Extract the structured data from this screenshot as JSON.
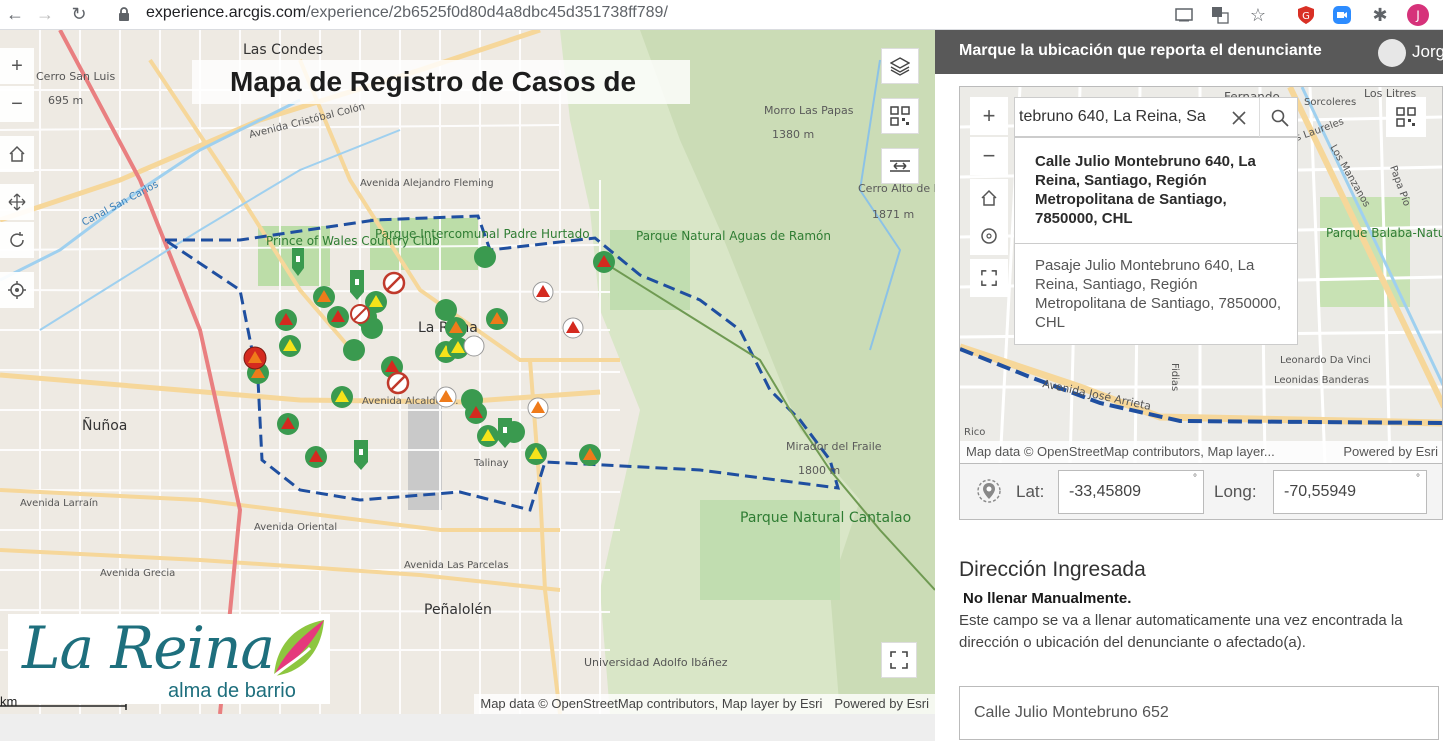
{
  "browser": {
    "url_domain": "experience.arcgis.com",
    "url_path": "/experience/2b6525f0d80d4a8dbc45d351738ff789/"
  },
  "map": {
    "title": "Mapa de Registro de Casos de",
    "labels": {
      "las_condes": "Las Condes",
      "cerro_san_luis": "Cerro San Luis",
      "cerro_san_luis_alt": "695 m",
      "morro_las_papas": "Morro Las Papas",
      "morro_alt": "1380 m",
      "cerro_alto": "Cerro Alto de las Vizcachas",
      "cerro_alto_alt": "1871 m",
      "parque_intercomunal": "Parque Intercomunal Padre Hurtado",
      "prince_of_wales": "Prince of Wales Country Club",
      "parque_aguas": "Parque Natural Aguas de Ramón",
      "la_reina": "La Reina",
      "nunoa": "Ñuñoa",
      "mirador": "Mirador del Fraile",
      "mirador_alt": "1800 m",
      "parque_cantalao": "Parque Natural Cantalao",
      "penalolen": "Peñalolén",
      "universidad": "Universidad Adolfo Ibáñez",
      "talinay": "Talinay",
      "av_cristobal_colon": "Avenida Cristóbal Colón",
      "av_alejandro_fleming": "Avenida Alejandro Fleming",
      "canal_san_carlos": "Canal San Carlos",
      "av_alcalde": "Avenida Alcalde F...",
      "av_grecia": "Avenida Grecia",
      "av_oriental": "Avenida Oriental",
      "av_larrain": "Avenida Larraín",
      "av_las_parcelas": "Avenida Las Parcelas"
    },
    "attribution": "Map data © OpenStreetMap contributors, Map layer by Esri",
    "powered_by": "Powered by Esri",
    "scale_unit": "km",
    "logo": {
      "main": "La Reina",
      "sub": "alma de barrio"
    }
  },
  "panel": {
    "header_text": "Marque la ubicación que reporta el denunciante",
    "user": "Jorg",
    "search": {
      "value": "tebruno 640, La Reina, Sa"
    },
    "suggestions": [
      "Calle Julio Montebruno 640, La Reina, Santiago, Región Metropolitana de Santiago, 7850000, CHL",
      "Pasaje Julio Montebruno 640, La Reina, Santiago, Región Metropolitana de Santiago, 7850000, CHL"
    ],
    "mini_map_labels": {
      "fernando": "Fernando",
      "parque_la_balaba": "Parque Balaba-Natural San Carlos",
      "leonardo": "Leonardo Da Vinci",
      "leonidas": "Leonidas Banderas",
      "av_jose_arrieta": "Avenida José Arrieta",
      "fidias": "Fidias",
      "rico": "Rico",
      "sorcoleres": "Sorcoleres",
      "los_laureles": "Los Laureles",
      "los_manzanos": "Los Manzanos",
      "papa_pio": "Papa Pío",
      "los_litres": "Los Litres"
    },
    "mini_attr": "Map data © OpenStreetMap contributors, Map layer...",
    "mini_powered": "Powered by Esri",
    "lat_label": "Lat:",
    "lat_value": "-33,45809",
    "long_label": "Long:",
    "long_value": "-70,55949",
    "degree": "°",
    "section_title": "Dirección Ingresada",
    "note_bold": "No llenar Manualmente.",
    "note_text": "Este campo se va a llenar automaticamente una vez encontrada la dirección o ubicación del denunciante o afectado(a).",
    "address_value": "Calle Julio Montebruno 652"
  },
  "colors": {
    "header_bg": "#595959",
    "boundary": "#1f4fa0",
    "marker_green": "#3a9a4f",
    "marker_red": "#d42a1f",
    "marker_orange": "#ef7b1a",
    "marker_yellow": "#f5e31a",
    "park_green": "#c8e2b4",
    "logo_teal": "#1e6f7d"
  }
}
